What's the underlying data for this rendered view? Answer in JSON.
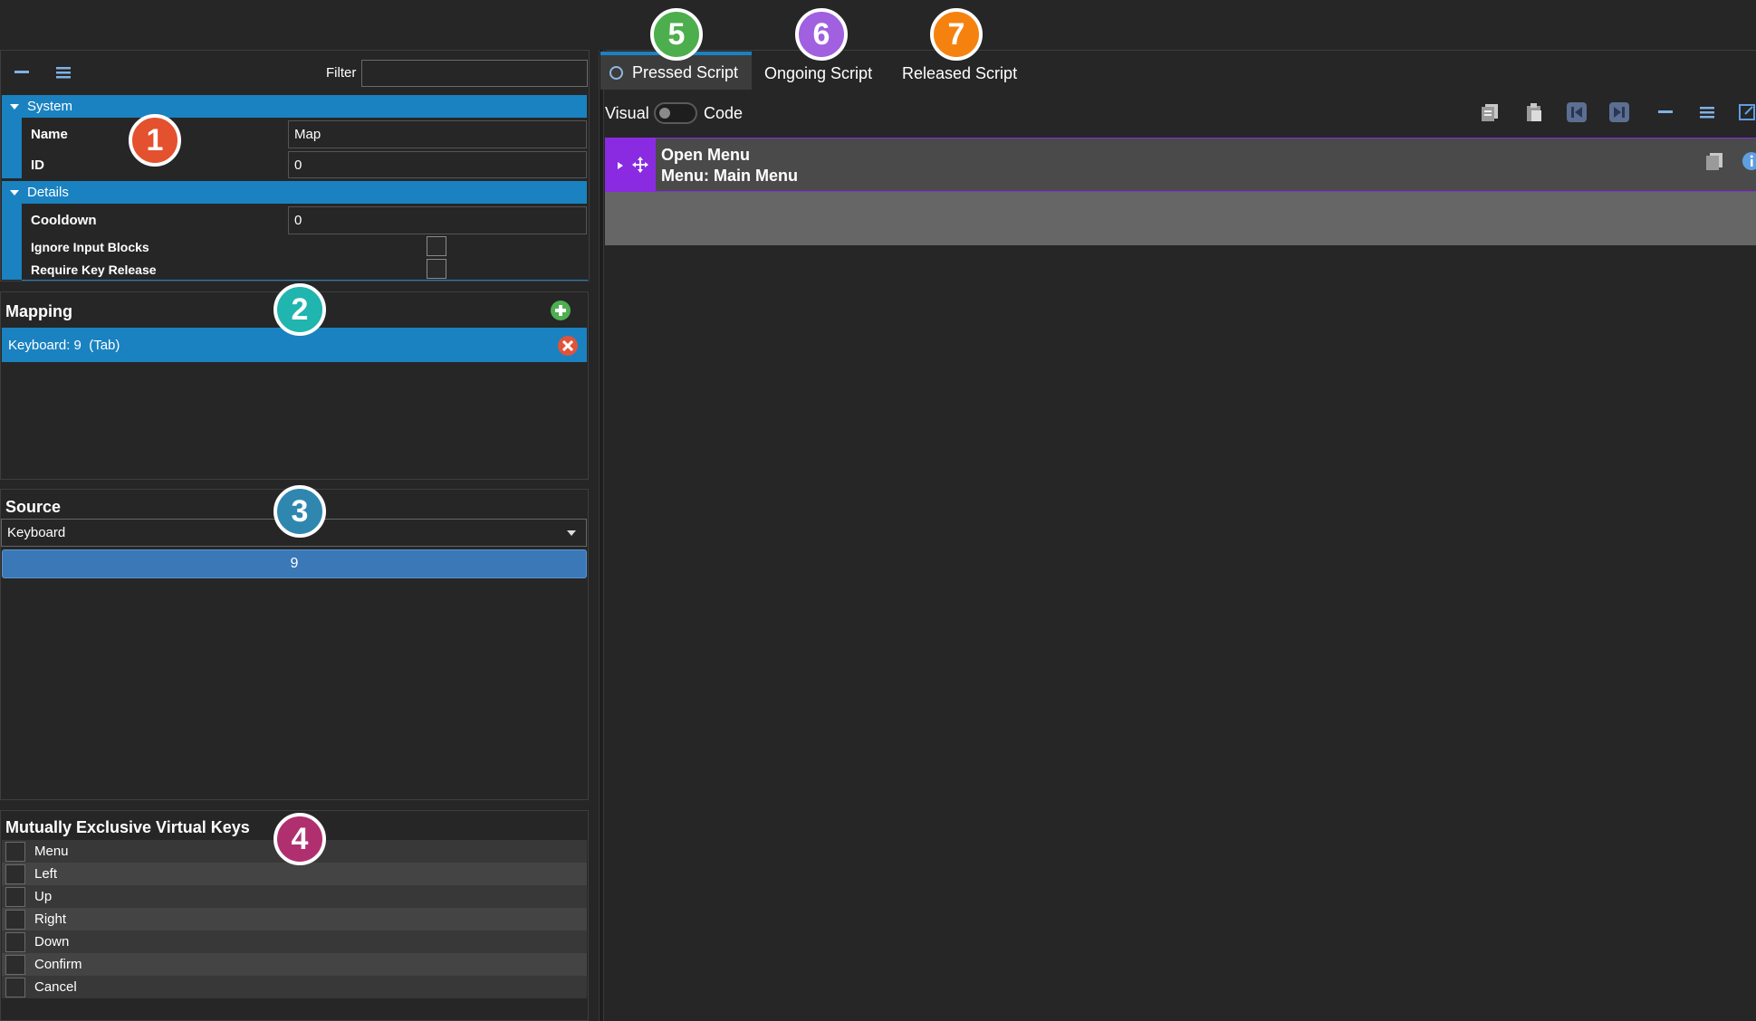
{
  "toolbar": {
    "filter_label": "Filter",
    "filter_value": ""
  },
  "properties": {
    "system_category": "System",
    "name_label": "Name",
    "name_value": "Map",
    "id_label": "ID",
    "id_value": "0",
    "details_category": "Details",
    "cooldown_label": "Cooldown",
    "cooldown_value": "0",
    "ignore_label": "Ignore Input Blocks",
    "require_label": "Require Key Release"
  },
  "mapping": {
    "title": "Mapping",
    "items": [
      "Keyboard: 9  (Tab)"
    ]
  },
  "source": {
    "title": "Source",
    "selected": "Keyboard",
    "key_value": "9"
  },
  "mutually_exclusive": {
    "title": "Mutually Exclusive Virtual Keys",
    "keys": [
      "Menu",
      "Left",
      "Up",
      "Right",
      "Down",
      "Confirm",
      "Cancel"
    ]
  },
  "tabs": [
    "Pressed Script",
    "Ongoing Script",
    "Released Script"
  ],
  "script_toggle": {
    "left": "Visual",
    "right": "Code"
  },
  "script_block": {
    "line1": "Open Menu",
    "line2": "Menu: Main Menu"
  },
  "callouts": {
    "c1": {
      "label": "1",
      "color": "#e4512f"
    },
    "c2": {
      "label": "2",
      "color": "#20b5ae"
    },
    "c3": {
      "label": "3",
      "color": "#2f87b0"
    },
    "c4": {
      "label": "4",
      "color": "#b0306f"
    },
    "c5": {
      "label": "5",
      "color": "#4cae4c"
    },
    "c6": {
      "label": "6",
      "color": "#a060e0"
    },
    "c7": {
      "label": "7",
      "color": "#f5820f"
    }
  },
  "colors": {
    "accent": "#1a82c0",
    "block_purple": "#8a2be2",
    "add_green": "#4caf50",
    "remove_red": "#e0533b"
  }
}
